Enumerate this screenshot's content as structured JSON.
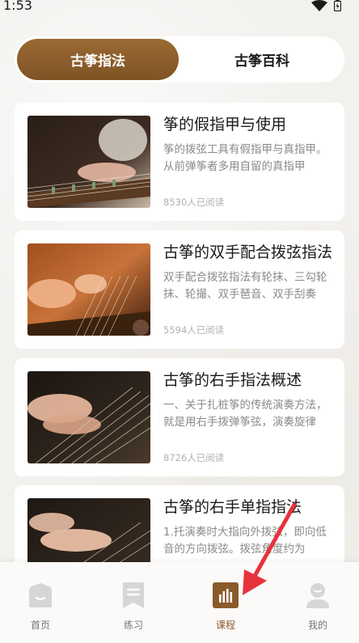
{
  "status_bar": {
    "time": "1:53",
    "icons": [
      "wifi-icon",
      "battery-icon"
    ]
  },
  "tabs": [
    {
      "label": "古筝指法",
      "active": true
    },
    {
      "label": "古筝百科",
      "active": false
    }
  ],
  "articles": [
    {
      "title": "筝的假指甲与使用",
      "desc": "筝的拨弦工具有假指甲与真指甲。从前弹筝者多用自留的真指甲",
      "reads": "8530人已阅读"
    },
    {
      "title": "古筝的双手配合拨弦指法",
      "desc": "双手配合拨弦指法有轮抹、三勾轮抹、轮撮、双手琶音、双手刮奏",
      "reads": "5594人已阅读"
    },
    {
      "title": "古筝的右手指法概述",
      "desc": "一、关于扎桩筝的传统演奏方法，就是用右手拨弹筝弦，演奏旋律",
      "reads": "8726人已阅读"
    },
    {
      "title": "古筝的右手单指指法",
      "desc": "1.托演奏时大指向外拨弦，即向低音的方向拨弦。拨弦角度约为",
      "reads": ""
    }
  ],
  "bottom_nav": [
    {
      "label": "首页",
      "icon": "home-icon",
      "active": false
    },
    {
      "label": "练习",
      "icon": "bookmark-icon",
      "active": false
    },
    {
      "label": "课程",
      "icon": "course-chart-icon",
      "active": true
    },
    {
      "label": "我的",
      "icon": "profile-icon",
      "active": false
    }
  ],
  "colors": {
    "accent": "#8b5a2b",
    "annotation": "#e8323c"
  }
}
